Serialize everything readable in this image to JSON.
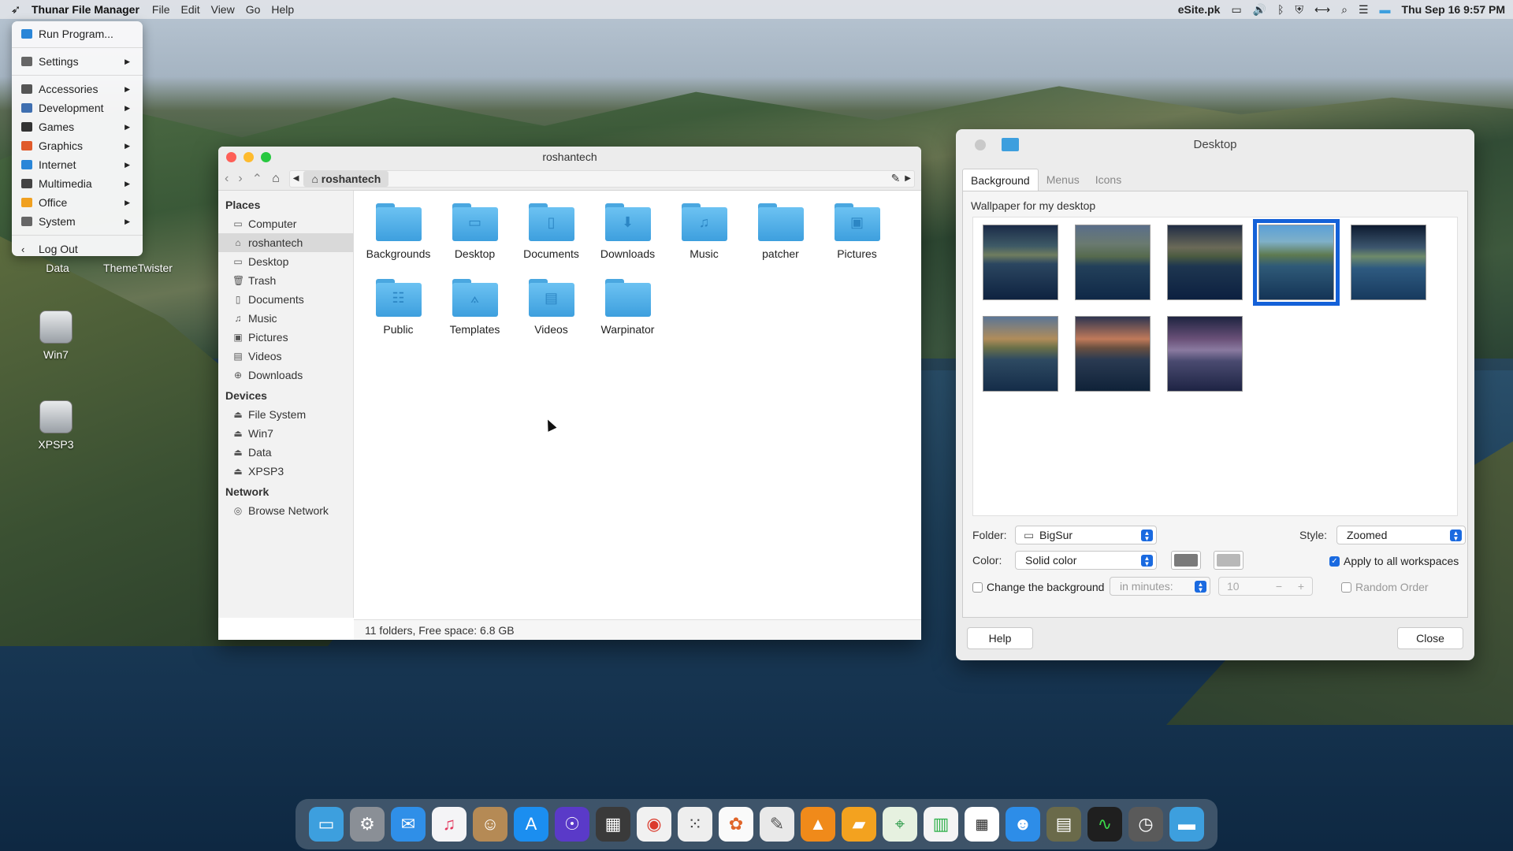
{
  "menubar": {
    "app_name": "Thunar File Manager",
    "items": [
      "File",
      "Edit",
      "View",
      "Go",
      "Help"
    ],
    "site": "eSite.pk",
    "datetime": "Thu Sep 16  9:57 PM"
  },
  "app_menu": {
    "run": "Run Program...",
    "settings": "Settings",
    "categories": [
      "Accessories",
      "Development",
      "Games",
      "Graphics",
      "Internet",
      "Multimedia",
      "Office",
      "System"
    ],
    "logout": "Log Out"
  },
  "desktop": {
    "icons": [
      "Data",
      "ThemeTwister",
      "Win7",
      "XPSP3"
    ]
  },
  "file_manager": {
    "title": "roshantech",
    "path": "roshantech",
    "places_header": "Places",
    "places": [
      "Computer",
      "roshantech",
      "Desktop",
      "Trash",
      "Documents",
      "Music",
      "Pictures",
      "Videos",
      "Downloads"
    ],
    "devices_header": "Devices",
    "devices": [
      "File System",
      "Win7",
      "Data",
      "XPSP3"
    ],
    "network_header": "Network",
    "network": [
      "Browse Network"
    ],
    "folders": [
      "Backgrounds",
      "Desktop",
      "Documents",
      "Downloads",
      "Music",
      "patcher",
      "Pictures",
      "Public",
      "Templates",
      "Videos",
      "Warpinator"
    ],
    "status": "11 folders, Free space: 6.8 GB"
  },
  "desktop_settings": {
    "title": "Desktop",
    "tabs": [
      "Background",
      "Menus",
      "Icons"
    ],
    "wallpaper_caption": "Wallpaper for my desktop",
    "folder_label": "Folder:",
    "folder_value": "BigSur",
    "style_label": "Style:",
    "style_value": "Zoomed",
    "color_label": "Color:",
    "color_value": "Solid color",
    "color1": "#7a7a7a",
    "color2": "#b8b8b8",
    "apply_all": "Apply to all workspaces",
    "change_bg": "Change the background",
    "interval_unit": "in minutes:",
    "interval_value": "10",
    "random_order": "Random Order",
    "help": "Help",
    "close": "Close"
  },
  "accent": "#1a6ae0"
}
